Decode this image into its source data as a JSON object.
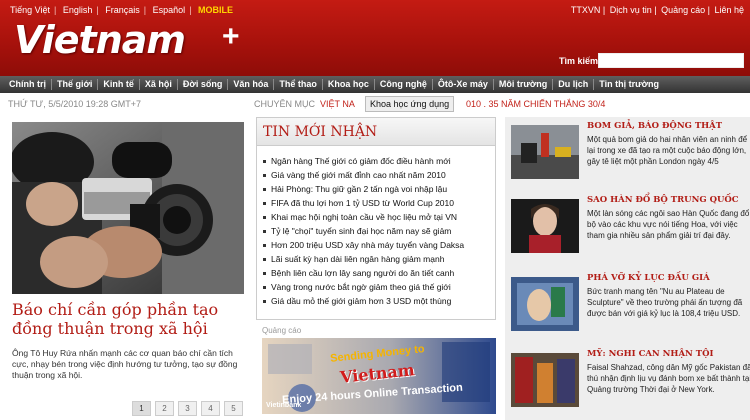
{
  "header": {
    "languages": [
      "Tiếng Việt",
      "English",
      "Français",
      "Español",
      "MOBILE"
    ],
    "top_links": [
      "TTXVN",
      "Dịch vụ tin",
      "Quảng cáo",
      "Liên hệ"
    ],
    "logo_text": "Vietnam",
    "search_label": "Tìm kiếm",
    "search_value": ""
  },
  "nav": {
    "items": [
      "Chính trị",
      "Thế giới",
      "Kinh tế",
      "Xã hội",
      "Đời sống",
      "Văn hóa",
      "Thể thao",
      "Khoa học",
      "Công nghệ",
      "Ôtô-Xe máy",
      "Môi trường",
      "Du lịch",
      "Tin thị trường"
    ]
  },
  "date_text": "THỨ TƯ, 5/5/2010 19:28 GMT+7",
  "category": {
    "label": "CHUYÊN MỤC",
    "selected": "VIỆT NA",
    "dropdown_value": "Khoa học ứng dụng",
    "extra": "010 . 35 NĂM CHIẾN THẮNG 30/4"
  },
  "feature": {
    "title": "Báo chí cần góp phần tạo đồng thuận trong xã hội",
    "summary": "Ông Tô Huy Rứa nhấn mạnh các cơ quan báo chí cần tích cực, nhạy bén trong việc định hướng tư tưởng, tạo sự đồng thuận trong xã hội."
  },
  "pager": [
    "1",
    "2",
    "3",
    "4",
    "5"
  ],
  "latest_news": {
    "title": "TIN MỚI NHẬN",
    "items": [
      "Ngân hàng Thế giới có giảm đốc điều hành mới",
      "Giá vàng thế giới mất đỉnh cao nhất năm 2010",
      "Hải Phòng: Thu giữ gần 2 tấn ngà voi nhập lậu",
      "FIFA đã thu lợi hơn 1 tỷ USD từ World Cup 2010",
      "Khai mạc hội nghị toàn cầu về học liệu mở tại VN",
      "Tỷ lệ \"chọi\" tuyển sinh đại học năm nay sẽ giảm",
      "Hơn 200 triệu USD xây nhà máy tuyển vàng Daksa",
      "Lãi suất kỳ hạn dài liên ngân hàng giảm mạnh",
      "Bệnh liên cầu lợn lây sang người do ăn tiết canh",
      "Vàng trong nước bắt ngờ giảm theo giá thế giới",
      "Giá dầu mỏ thế giới giảm hơn 3 USD một thùng"
    ]
  },
  "ad": {
    "label": "Quảng cáo",
    "line1": "Sending Money to",
    "line2": "Vietnam",
    "line3": "Enjoy 24 hours Online Transaction",
    "brand": "Vietinbank"
  },
  "stories": [
    {
      "title": "BOM GIẢ, BÁO ĐỘNG THẬT",
      "body": "Một quả bom giả do hai nhân viên an ninh để lại trong xe đã tạo ra một cuộc báo động lớn, gây tê liệt một phần London ngày 4/5"
    },
    {
      "title": "SAO HÀN ĐỔ BỘ TRUNG QUỐC",
      "body": "Một làn sóng các ngôi sao Hàn Quốc đang đổ bộ vào các khu vực nói tiếng Hoa, với việc tham gia nhiều sản phẩm giải trí đại đây."
    },
    {
      "title": "PHÁ VỠ KỶ LỤC ĐẤU GIÁ",
      "body": "Bức tranh mang tên \"Nu au Plateau de Sculpture\" về theo trường phái ấn tượng đã được bán với giá kỷ lục là 108,4 triệu USD."
    },
    {
      "title": "MỸ: NGHI CAN NHẬN TỘI",
      "body": "Faisal Shahzad, công dân Mỹ gốc Pakistan đã thú nhận định lịu vụ đánh bom xe bất thành tại Quảng trường Thời đại ở New York."
    }
  ]
}
